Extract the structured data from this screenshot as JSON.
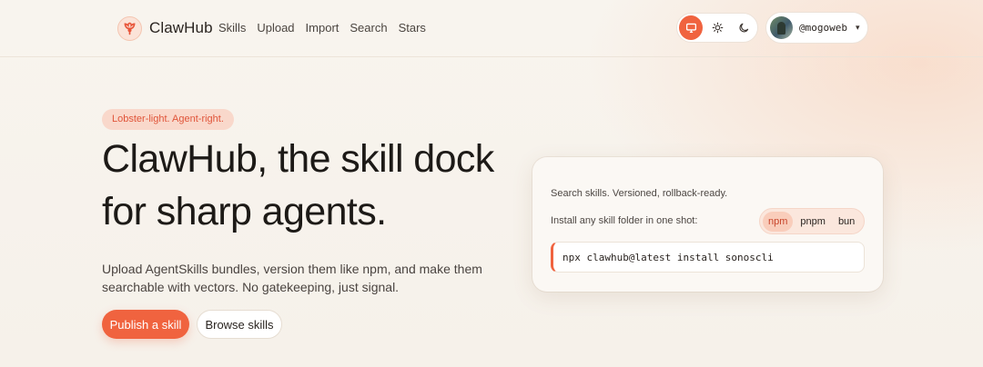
{
  "brand": {
    "name": "ClawHub",
    "logo_icon": "lobster-icon",
    "accent": "#f0633f"
  },
  "nav": {
    "items": [
      {
        "label": "Skills"
      },
      {
        "label": "Upload"
      },
      {
        "label": "Import"
      },
      {
        "label": "Search"
      },
      {
        "label": "Stars"
      }
    ]
  },
  "theme_toggle": {
    "options": [
      "monitor-icon",
      "sun-icon",
      "moon-icon"
    ],
    "selected": "monitor-icon"
  },
  "user": {
    "username": "@mogoweb",
    "caret": "▾"
  },
  "hero": {
    "tagline": "Lobster-light. Agent-right.",
    "headline_line1": "ClawHub, the skill dock",
    "headline_line2": "for sharp agents.",
    "subtext_line1": "Upload AgentSkills bundles, version them like npm, and make them",
    "subtext_line2": "searchable with vectors. No gatekeeping, just signal.",
    "primary_button": "Publish a skill",
    "secondary_button": "Browse skills"
  },
  "install_card": {
    "line1": "Search skills. Versioned, rollback-ready.",
    "line2": "Install any skill folder in one shot:",
    "package_managers": [
      "npm",
      "pnpm",
      "bun"
    ],
    "selected_pm": "npm",
    "command": "npx clawhub@latest install sonoscli"
  }
}
